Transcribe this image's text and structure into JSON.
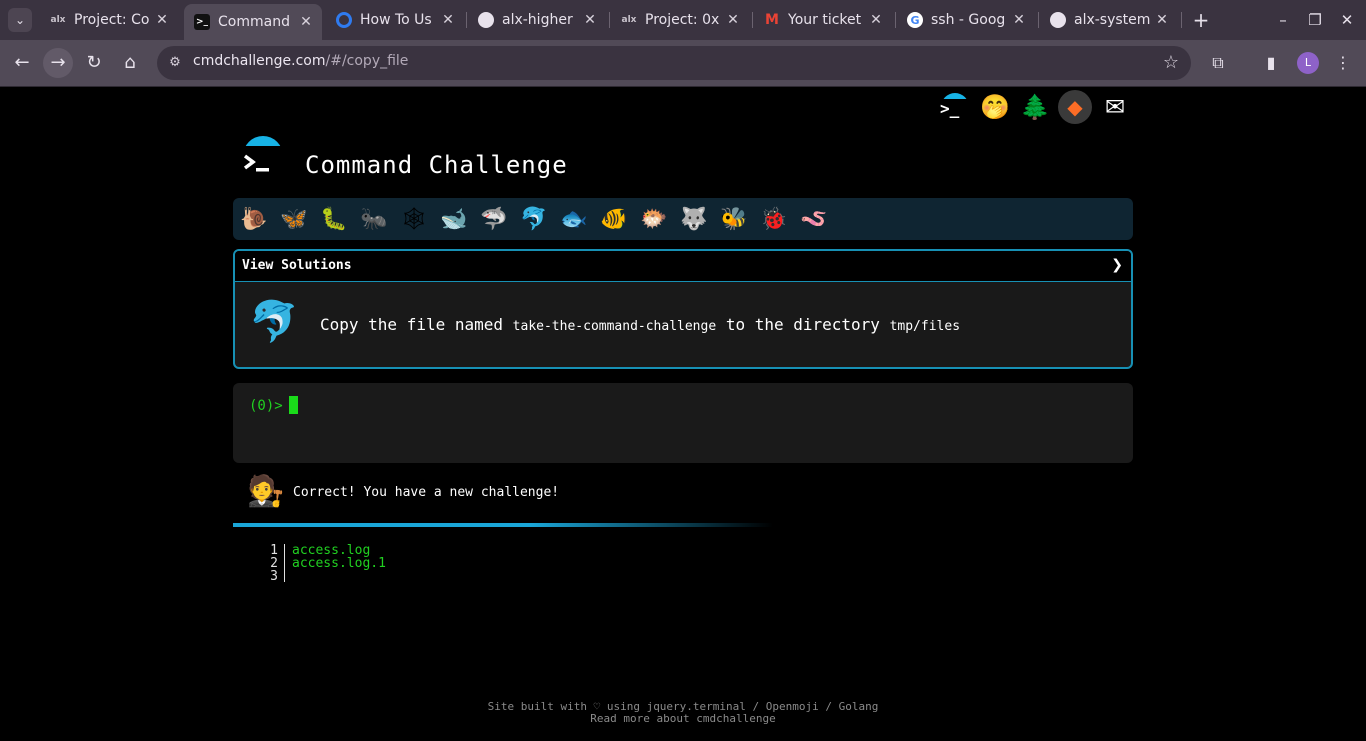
{
  "browser": {
    "tabs": [
      {
        "title": "Project: Co",
        "favicon": "alx-logo",
        "active": false
      },
      {
        "title": "Command",
        "favicon": "terminal-icon",
        "active": true
      },
      {
        "title": "How To Us",
        "favicon": "digitalocean-icon",
        "active": false
      },
      {
        "title": "alx-higher",
        "favicon": "github-icon",
        "active": false
      },
      {
        "title": "Project: 0x",
        "favicon": "alx-logo",
        "active": false
      },
      {
        "title": "Your ticket",
        "favicon": "gmail-icon",
        "active": false
      },
      {
        "title": "ssh - Goog",
        "favicon": "google-icon",
        "active": false
      },
      {
        "title": "alx-system",
        "favicon": "github-icon",
        "active": false
      }
    ],
    "favicon_text": {
      "alx": "alx"
    },
    "url": {
      "domain": "cmdchallenge.com",
      "path": "/#/copy_file"
    },
    "profile_initial": "L"
  },
  "page": {
    "title": "Command Challenge",
    "view_solutions": "View Solutions",
    "view_solutions_arrow": "❯",
    "task": {
      "prefix": "Copy the file named",
      "file": "take-the-command-challenge",
      "middle": "to the directory",
      "dir": "tmp/files"
    },
    "prompt": "(0)>",
    "result_message": "Correct! You have a new challenge!",
    "listing": [
      {
        "n": "1",
        "v": "access.log"
      },
      {
        "n": "2",
        "v": "access.log.1"
      },
      {
        "n": "3",
        "v": ""
      }
    ],
    "footer": {
      "line1": "Site built with ♡ using jquery.terminal / Openmoji / Golang",
      "line2": "Read more about cmdchallenge"
    },
    "colors": {
      "accent": "#17b3e6",
      "prompt_green": "#21d021",
      "emoji_bar_bg": "#0f2532",
      "border": "#1790b4"
    }
  }
}
